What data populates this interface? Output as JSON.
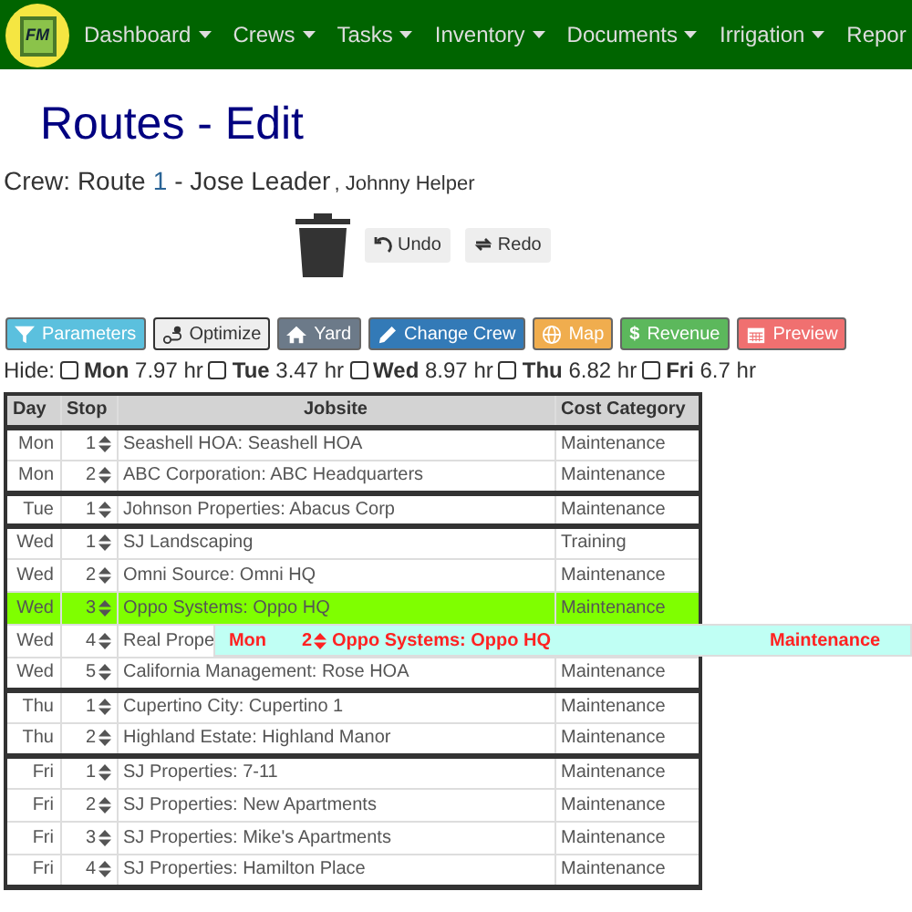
{
  "nav": {
    "logo_text": "FM",
    "items": [
      {
        "label": "Dashboard",
        "caret": true
      },
      {
        "label": "Crews",
        "caret": true
      },
      {
        "label": "Tasks",
        "caret": true
      },
      {
        "label": "Inventory",
        "caret": true
      },
      {
        "label": "Documents",
        "caret": true
      },
      {
        "label": "Irrigation",
        "caret": true
      },
      {
        "label": "Repor",
        "caret": false
      }
    ]
  },
  "title": "Routes - Edit",
  "crew": {
    "prefix": "Crew: Route",
    "route_number": "1",
    "leader": "- Jose Leader",
    "helper": ", Johnny Helper"
  },
  "actions": [
    {
      "label": "Undo",
      "kind": "undo"
    },
    {
      "label": "Redo",
      "kind": "redo"
    }
  ],
  "toolbar": [
    {
      "label": "Parameters",
      "kind": "filter",
      "color": "#5bc0de"
    },
    {
      "label": "Optimize",
      "kind": "optimize",
      "color": "#eeeeee"
    },
    {
      "label": "Yard",
      "kind": "home",
      "color": "#6c7a89"
    },
    {
      "label": "Change Crew",
      "kind": "pencil",
      "color": "#337ab7"
    },
    {
      "label": "Map",
      "kind": "globe",
      "color": "#f0ad4e"
    },
    {
      "label": "Revenue",
      "kind": "dollar",
      "icon_char": "$",
      "color": "#5cb85c"
    },
    {
      "label": "Preview",
      "kind": "calendar",
      "color": "#f07070"
    }
  ],
  "hide": {
    "label": "Hide:",
    "days": [
      {
        "day": "Mon",
        "hours": "7.97 hr",
        "checked": false
      },
      {
        "day": "Tue",
        "hours": "3.47 hr",
        "checked": false
      },
      {
        "day": "Wed",
        "hours": "8.97 hr",
        "checked": false
      },
      {
        "day": "Thu",
        "hours": "6.82 hr",
        "checked": false
      },
      {
        "day": "Fri",
        "hours": "6.7 hr",
        "checked": false
      }
    ]
  },
  "table": {
    "columns": [
      "Day",
      "Stop",
      "Jobsite",
      "Cost Category"
    ],
    "groups": [
      {
        "rows": [
          {
            "day": "Mon",
            "stop": "1",
            "jobsite": "Seashell HOA: Seashell HOA",
            "cost_category": "Maintenance",
            "selected": false
          },
          {
            "day": "Mon",
            "stop": "2",
            "jobsite": "ABC Corporation: ABC Headquarters",
            "cost_category": "Maintenance",
            "selected": false
          }
        ]
      },
      {
        "rows": [
          {
            "day": "Tue",
            "stop": "1",
            "jobsite": "Johnson Properties: Abacus Corp",
            "cost_category": "Maintenance",
            "selected": false
          }
        ]
      },
      {
        "rows": [
          {
            "day": "Wed",
            "stop": "1",
            "jobsite": "SJ Landscaping",
            "cost_category": "Training",
            "selected": false
          },
          {
            "day": "Wed",
            "stop": "2",
            "jobsite": "Omni Source: Omni HQ",
            "cost_category": "Maintenance",
            "selected": false
          },
          {
            "day": "Wed",
            "stop": "3",
            "jobsite": "Oppo Systems: Oppo HQ",
            "cost_category": "Maintenance",
            "selected": true
          },
          {
            "day": "Wed",
            "stop": "4",
            "jobsite": "Real Prope",
            "selected": false
          },
          {
            "day": "Wed",
            "stop": "5",
            "jobsite": "California Management: Rose HOA",
            "cost_category": "Maintenance",
            "selected": false
          }
        ]
      },
      {
        "rows": [
          {
            "day": "Thu",
            "stop": "1",
            "jobsite": "Cupertino City: Cupertino 1",
            "cost_category": "Maintenance",
            "selected": false
          },
          {
            "day": "Thu",
            "stop": "2",
            "jobsite": "Highland Estate: Highland Manor",
            "cost_category": "Maintenance",
            "selected": false
          }
        ]
      },
      {
        "rows": [
          {
            "day": "Fri",
            "stop": "1",
            "jobsite": "SJ Properties: 7-11",
            "cost_category": "Maintenance",
            "selected": false
          },
          {
            "day": "Fri",
            "stop": "2",
            "jobsite": "SJ Properties: New Apartments",
            "cost_category": "Maintenance",
            "selected": false
          },
          {
            "day": "Fri",
            "stop": "3",
            "jobsite": "SJ Properties: Mike's Apartments",
            "cost_category": "Maintenance",
            "selected": false
          },
          {
            "day": "Fri",
            "stop": "4",
            "jobsite": "SJ Properties: Hamilton Place",
            "cost_category": "Maintenance",
            "selected": false
          }
        ]
      }
    ]
  },
  "dragging_row": {
    "day": "Mon",
    "stop": "2",
    "jobsite": "Oppo Systems: Oppo HQ",
    "cost_category": "Maintenance"
  }
}
